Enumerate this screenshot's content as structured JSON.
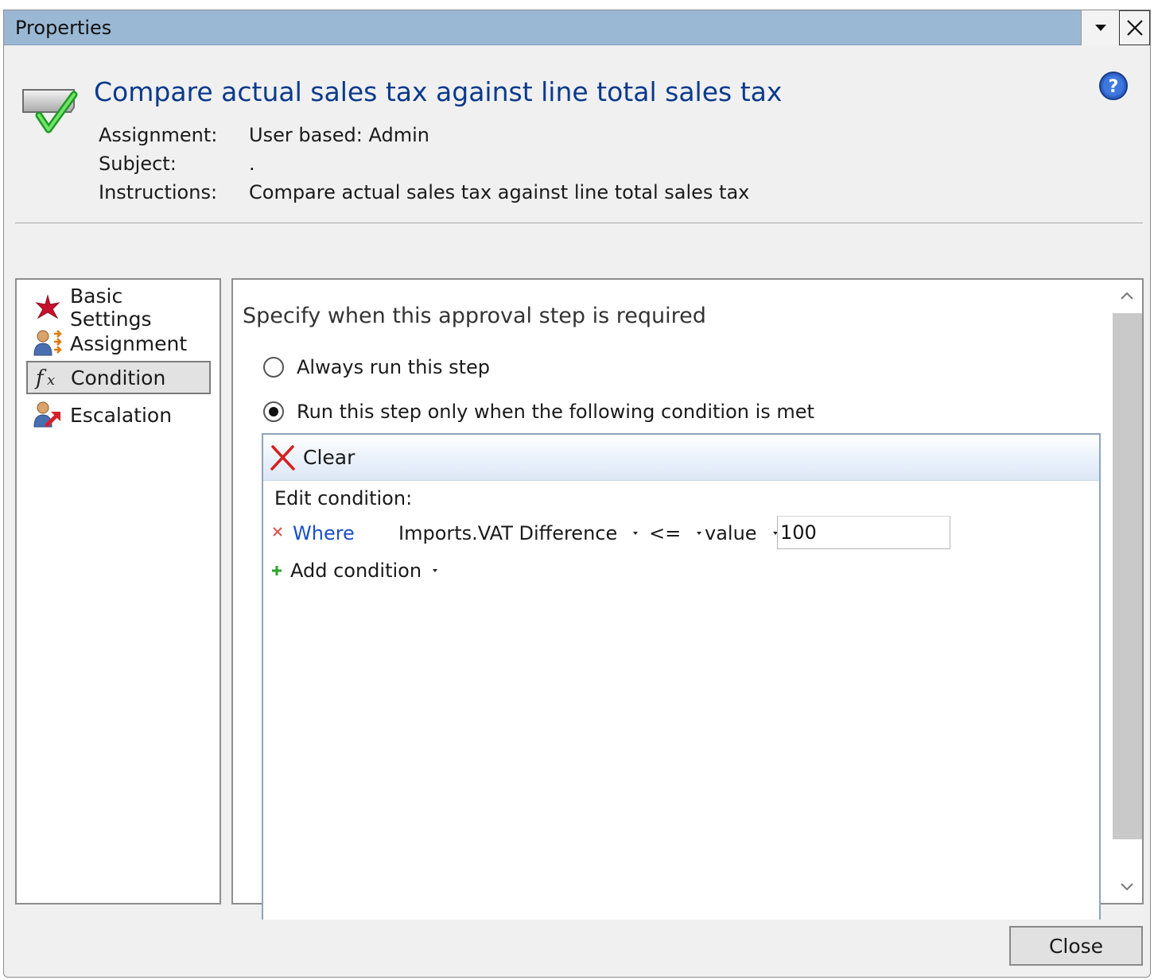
{
  "window": {
    "title": "Properties",
    "dropdown_icon": "triangle-down-icon",
    "close_icon": "x-icon"
  },
  "header": {
    "title": "Compare actual sales tax against line total sales tax",
    "title_color": "#0a3a8c",
    "icon": "approval-check-icon",
    "help_icon": "help-question-icon",
    "fields": [
      {
        "label": "Assignment:",
        "value": "User based: Admin"
      },
      {
        "label": "Subject:",
        "value": "."
      },
      {
        "label": "Instructions:",
        "value": "Compare actual sales tax against line total sales tax"
      }
    ]
  },
  "nav": {
    "items": [
      {
        "label": "Basic Settings",
        "icon": "red-asterisk-icon",
        "selected": false
      },
      {
        "label": "Assignment",
        "icon": "user-assignment-icon",
        "selected": false
      },
      {
        "label": "Condition",
        "icon": "function-fx-icon",
        "selected": true
      },
      {
        "label": "Escalation",
        "icon": "user-escalation-icon",
        "selected": false
      }
    ]
  },
  "content": {
    "heading": "Specify when this approval step is required",
    "options": [
      {
        "label": "Always run this step",
        "checked": false
      },
      {
        "label": "Run this step only when the following condition is met",
        "checked": true
      }
    ],
    "toolbar": {
      "clear_label": "Clear",
      "clear_icon": "red-x-icon"
    },
    "edit_label": "Edit condition:",
    "condition": {
      "remove_icon": "small-red-x-icon",
      "where_label": "Where",
      "field": "Imports.VAT Difference",
      "operator": "<=",
      "value_type": "value",
      "value": "100"
    },
    "add_condition_label": "Add condition",
    "add_icon": "green-plus-icon"
  },
  "footer": {
    "close_label": "Close"
  }
}
